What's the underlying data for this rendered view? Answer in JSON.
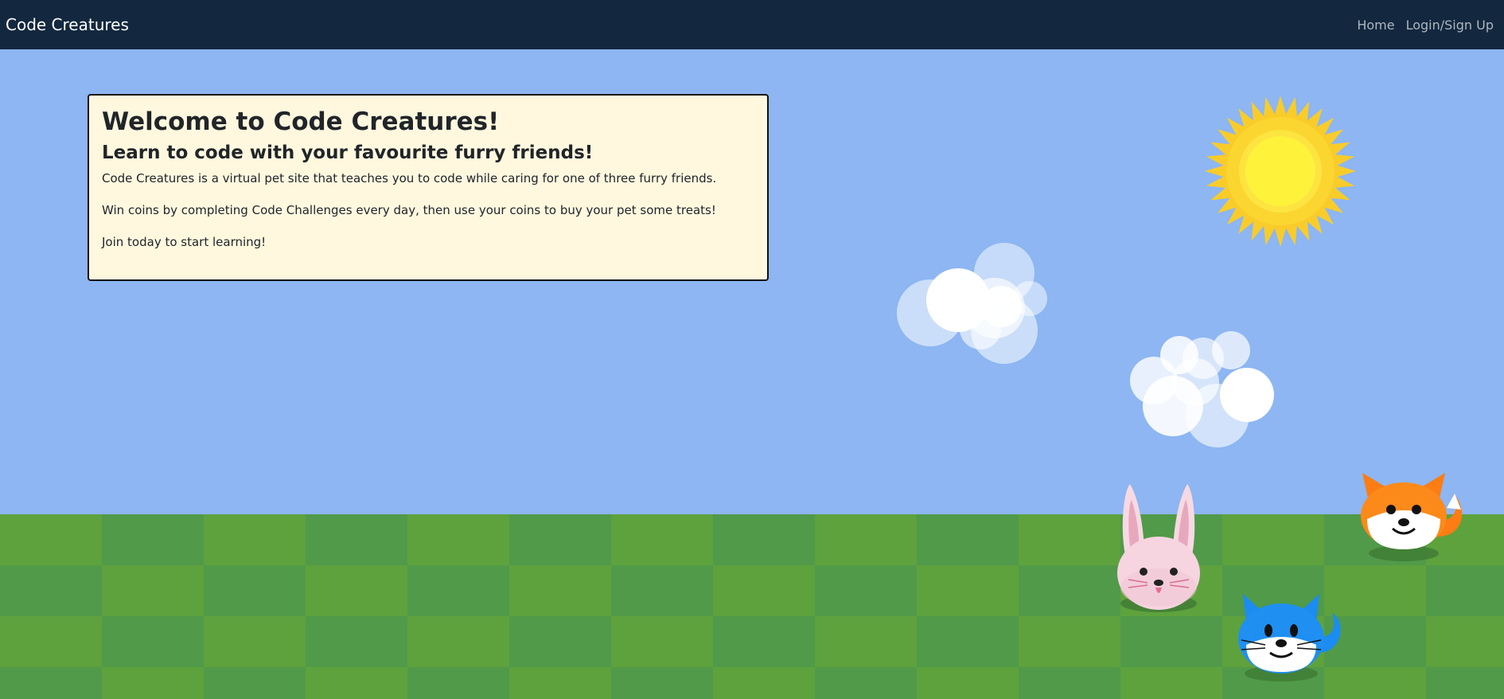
{
  "navbar": {
    "brand": "Code Creatures",
    "links": [
      {
        "label": "Home"
      },
      {
        "label": "Login/Sign Up"
      }
    ]
  },
  "welcome": {
    "title": "Welcome to Code Creatures!",
    "subtitle": "Learn to code with your favourite furry friends!",
    "paragraphs": [
      "Code Creatures is a virtual pet site that teaches you to code while caring for one of three furry friends.",
      "Win coins by completing Code Challenges every day, then use your coins to buy your pet some treats!",
      "Join today to start learning!"
    ]
  },
  "colors": {
    "navbar": "#13283f",
    "sky": "#8db6f2",
    "grass_light": "#5ea23d",
    "grass_dark": "#519a49",
    "card": "#fff8df"
  },
  "decorations": [
    "sun-icon",
    "cloud-icon",
    "cloud-icon",
    "rabbit-icon",
    "fox-icon",
    "cat-icon"
  ]
}
